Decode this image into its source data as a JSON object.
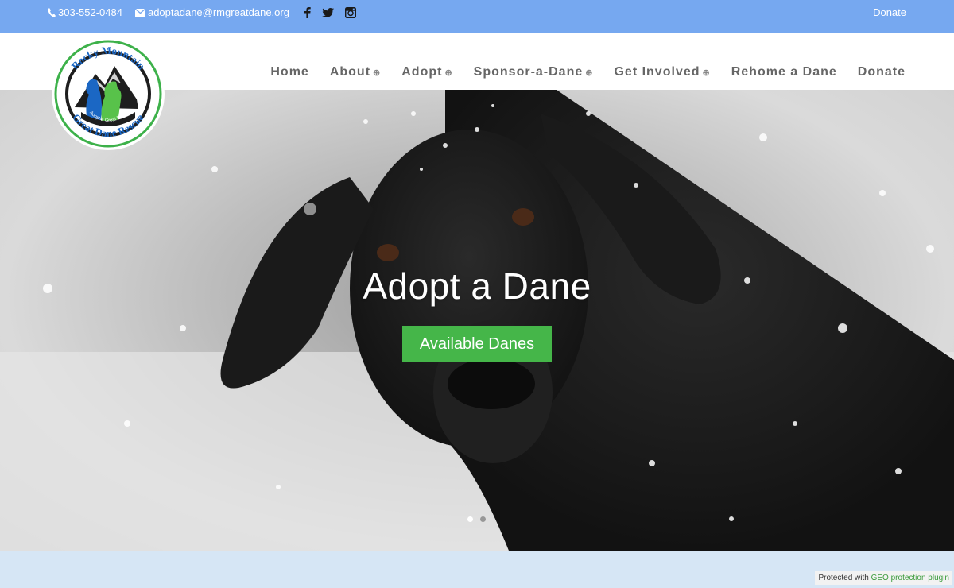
{
  "topbar": {
    "phone": "303-552-0484",
    "email": "adoptadane@rmgreatdane.org",
    "social": [
      "facebook-icon",
      "twitter-icon",
      "instagram-icon"
    ],
    "donate": "Donate"
  },
  "logo": {
    "top_text": "Rocky Mountain",
    "tagline": "Add Character to Your Life",
    "inner_text": "Adopt a Great Dane",
    "bottom_text": "Great Dane Rescue"
  },
  "nav": {
    "items": [
      {
        "label": "Home",
        "has_submenu": false
      },
      {
        "label": "About",
        "has_submenu": true
      },
      {
        "label": "Adopt",
        "has_submenu": true
      },
      {
        "label": "Sponsor-a-Dane",
        "has_submenu": true
      },
      {
        "label": "Get Involved",
        "has_submenu": true
      },
      {
        "label": "Rehome a Dane",
        "has_submenu": false
      },
      {
        "label": "Donate",
        "has_submenu": false
      }
    ],
    "submenu_glyph": "⊕"
  },
  "hero": {
    "title": "Adopt a Dane",
    "button": "Available Danes",
    "active_slide": 1,
    "slide_count": 2
  },
  "footer_badge": {
    "prefix": "Protected with",
    "link": "GEO protection plugin"
  },
  "colors": {
    "topbar": "#76a8f0",
    "button": "#45b649",
    "nav_text": "#666666",
    "footer_bg": "#d6e6f5"
  }
}
